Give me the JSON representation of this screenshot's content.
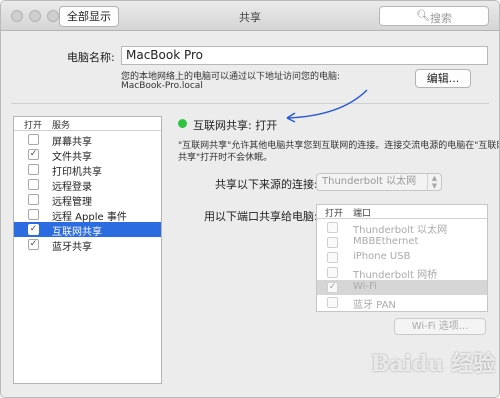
{
  "titlebar": {
    "show_all": "全部显示",
    "title": "共享",
    "search_placeholder": "搜索",
    "back": "‹",
    "forward": "›",
    "search_icon": "magnifier-icon"
  },
  "computer": {
    "label": "电脑名称:",
    "name": "MacBook Pro",
    "hint": "您的本地网络上的电脑可以通过以下地址访问您的电脑:",
    "address": "MacBook-Pro.local",
    "edit": "编辑..."
  },
  "services": {
    "col_on": "打开",
    "col_service": "服务",
    "items": [
      {
        "label": "屏幕共享",
        "checked": false
      },
      {
        "label": "文件共享",
        "checked": true
      },
      {
        "label": "打印机共享",
        "checked": false
      },
      {
        "label": "远程登录",
        "checked": false
      },
      {
        "label": "远程管理",
        "checked": false
      },
      {
        "label": "远程 Apple 事件",
        "checked": false
      },
      {
        "label": "互联网共享",
        "checked": true,
        "selected": true
      },
      {
        "label": "蓝牙共享",
        "checked": true
      }
    ]
  },
  "detail": {
    "status": "互联网共享: 打开",
    "description_1": "\"互联网共享\"允许其他电脑共享您到互联网的连接。连接交流电源的电脑在\"互联网",
    "description_2": "共享\"打开时不会休眠。",
    "share_from_label": "共享以下来源的连接:",
    "share_from_value": "Thunderbolt 以太网",
    "share_to_label": "用以下端口共享给电脑:",
    "port_col_on": "打开",
    "port_col_port": "端口",
    "ports": [
      {
        "label": "Thunderbolt 以太网",
        "checked": false
      },
      {
        "label": "MBBEthernet",
        "checked": false
      },
      {
        "label": "iPhone USB",
        "checked": false
      },
      {
        "label": "Thunderbolt 网桥",
        "checked": false
      },
      {
        "label": "Wi-Fi",
        "checked": true,
        "selected": true
      },
      {
        "label": "蓝牙 PAN",
        "checked": false
      }
    ],
    "wifi_options": "Wi-Fi 选项..."
  },
  "watermark": "Baidu 经验",
  "colors": {
    "selection": "#2c6ce1",
    "status_green": "#2fc43f",
    "annotation_arrow": "#2a5bd7"
  }
}
